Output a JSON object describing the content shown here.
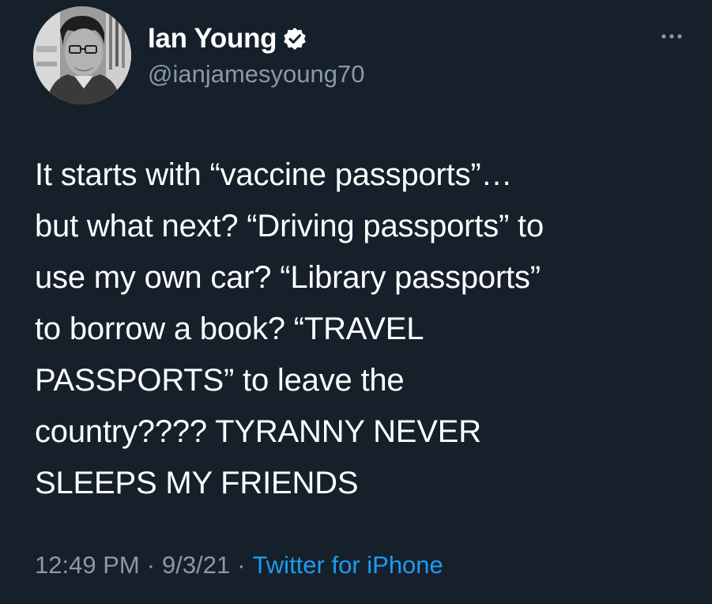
{
  "author": {
    "display_name": "Ian Young",
    "handle": "@ianjamesyoung70",
    "verified_icon": "verified-badge-icon"
  },
  "tweet": {
    "text": "It starts with “vaccine passports”…\nbut what next? “Driving passports” to\nuse my own car? “Library passports”\nto borrow a book? “TRAVEL\nPASSPORTS” to leave the\ncountry???? TYRANNY NEVER\nSLEEPS MY FRIENDS",
    "time": "12:49 PM",
    "date": "9/3/21",
    "source": "Twitter for iPhone",
    "separator": "·"
  },
  "menu": {
    "icon": "more-options-icon"
  },
  "colors": {
    "background": "#15202b",
    "primary_text": "#ffffff",
    "secondary_text": "#8b98a5",
    "link": "#1d9bf0"
  }
}
